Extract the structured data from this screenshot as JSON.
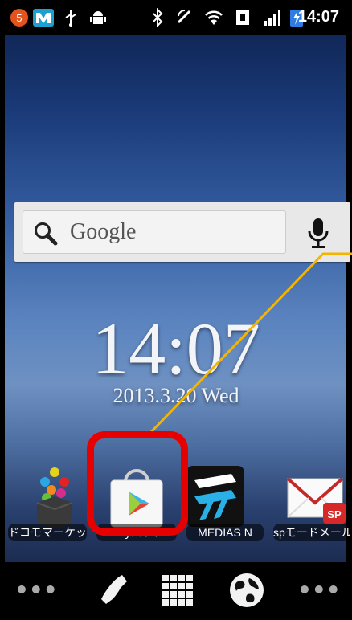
{
  "status_bar": {
    "time": "14:07",
    "notification_count": "5",
    "icons": [
      "notification-badge-icon",
      "app-m-icon",
      "usb-icon",
      "android-debug-icon",
      "bluetooth-icon",
      "rotation-icon",
      "wifi-icon",
      "data-icon",
      "signal-icon",
      "battery-charging-icon"
    ]
  },
  "search_widget": {
    "text": "Google"
  },
  "clock": {
    "time": "14:07",
    "date": "2013.3.20  Wed"
  },
  "apps": [
    {
      "label": "ドコモマーケット",
      "icon": "docomo-market-icon"
    },
    {
      "label": "Playストア",
      "icon": "play-store-icon"
    },
    {
      "label": "MEDIAS N",
      "icon": "medias-icon"
    },
    {
      "label": "spモードメール",
      "icon": "sp-mode-mail-icon"
    }
  ],
  "dock": {
    "left_dots": "•••",
    "right_dots": "•••",
    "icons": [
      "phone-icon",
      "app-drawer-icon",
      "browser-icon"
    ]
  },
  "colors": {
    "highlight": "#e60000",
    "pointer_line": "#f5b400"
  }
}
